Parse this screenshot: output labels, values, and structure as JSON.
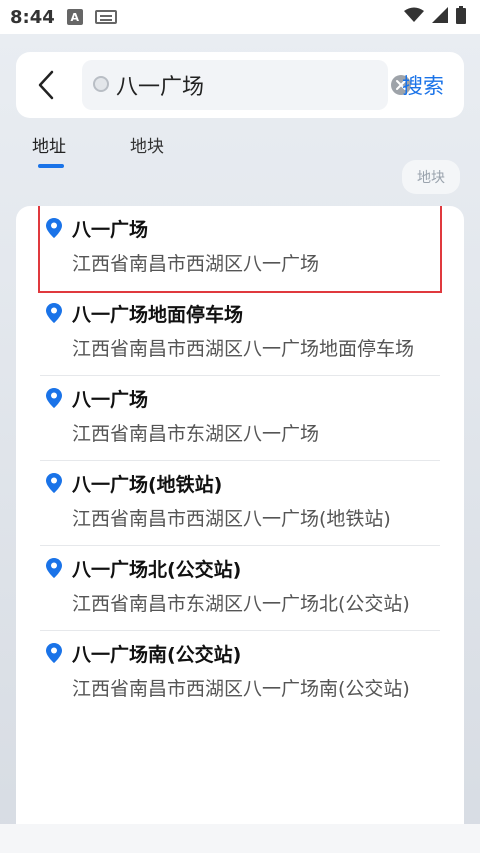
{
  "status": {
    "time": "8:44",
    "a_icon": "A"
  },
  "search": {
    "back_icon": "chevron-left-icon",
    "value": "八一广场",
    "clear_icon": "clear-icon",
    "button_label": "搜索"
  },
  "tabs": [
    {
      "label": "地址",
      "active": true
    },
    {
      "label": "地块",
      "active": false
    }
  ],
  "background": {
    "chip1": "地块"
  },
  "results": [
    {
      "title": "八一广场",
      "address": "江西省南昌市西湖区八一广场",
      "selected": true
    },
    {
      "title": "八一广场地面停车场",
      "address": "江西省南昌市西湖区八一广场地面停车场",
      "selected": false
    },
    {
      "title": "八一广场",
      "address": "江西省南昌市东湖区八一广场",
      "selected": false
    },
    {
      "title": "八一广场(地铁站)",
      "address": "江西省南昌市西湖区八一广场(地铁站)",
      "selected": false
    },
    {
      "title": "八一广场北(公交站)",
      "address": "江西省南昌市东湖区八一广场北(公交站)",
      "selected": false
    },
    {
      "title": "八一广场南(公交站)",
      "address": "江西省南昌市西湖区八一广场南(公交站)",
      "selected": false
    }
  ],
  "colors": {
    "accent": "#1a73e8",
    "highlight": "#e0393e"
  }
}
